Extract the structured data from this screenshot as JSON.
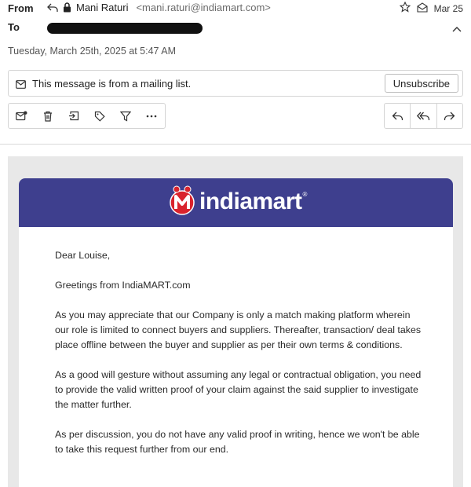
{
  "header": {
    "from_label": "From",
    "to_label": "To",
    "sender_name": "Mani Raturi",
    "sender_email": "<mani.raturi@indiamart.com>",
    "short_date": "Mar 25",
    "full_date": "Tuesday, March 25th, 2025 at 5:47 AM"
  },
  "mailing_list": {
    "notice": "This message is from a mailing list.",
    "unsubscribe_label": "Unsubscribe"
  },
  "toolbar": {
    "left_icons": [
      "mark-unread-icon",
      "trash-icon",
      "move-to-folder-icon",
      "label-tag-icon",
      "filter-icon",
      "more-icon"
    ],
    "right_icons": [
      "reply-icon",
      "reply-all-icon",
      "forward-icon"
    ]
  },
  "email": {
    "logo_text": "indiamart",
    "brand_colors": {
      "banner": "#3e3f8e",
      "logo_red": "#d9232d"
    },
    "paragraphs": [
      "Dear Louise,",
      "Greetings from IndiaMART.com",
      "As you may appreciate that our Company is only a match making platform wherein our role is limited to connect buyers and suppliers. Thereafter, transaction/ deal takes place offline between the buyer and supplier as per their own terms & conditions.",
      "As a good will gesture without assuming any legal or contractual obligation, you need to provide the valid written proof of your claim against the said supplier to investigate the matter further.",
      "As per discussion, you do not have any valid proof in writing, hence we won't be able to take this request further from our end."
    ]
  }
}
